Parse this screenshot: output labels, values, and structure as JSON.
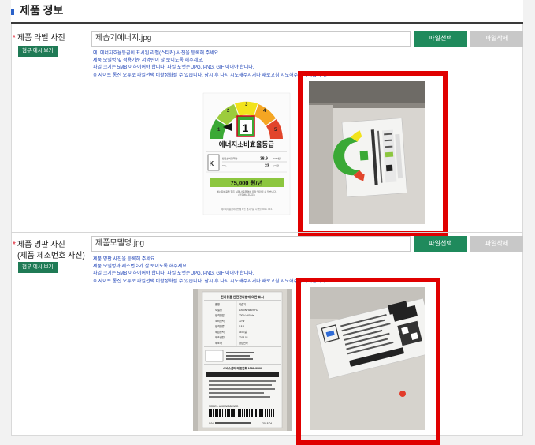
{
  "section": {
    "title": "제품 정보"
  },
  "rows": [
    {
      "label_lines": [
        "제품 라벨 사진"
      ],
      "example_button": "첨부 예시 보기",
      "file_name": "제습기에너지.jpg",
      "select_label": "파일선택",
      "delete_label": "파일삭제",
      "help_lines": [
        "예: 에너지효율등급이 표시된 라벨(스티커) 사진을 등록해 주세요.",
        "제품 모델명 및 적용기준 서명란이 잘 보이도록 해주세요.",
        "파일 크기는 5MB 이하이어야 합니다. 파일 포맷은 JPG, PNG, GIF 이어야 합니다.",
        "※ 사이트 통신 오류로 파일선택 비활성화될 수 있습니다. 잠시 후 다시 시도해주시거나 새로고침 시도해주시기 바랍니다."
      ],
      "energy_label": {
        "grades": [
          "1",
          "2",
          "3",
          "4",
          "5"
        ],
        "current_grade": "1",
        "title": "에너지소비효율등급",
        "rows": [
          {
            "k": "월간소비전력량",
            "v": "38.9",
            "u": "kWh/월"
          },
          {
            "k": "CO₂",
            "v": "23",
            "u": "g/시간"
          }
        ],
        "cost": "75,000 원/년",
        "note_lines": [
          "에너지비용을 힘든 실제 사용환경에 따라 달라질 수 있습니다.",
          "(한국에너지공단)"
        ],
        "footer": "에너지이용합리화법에 따른 효시기준 시행일 2016. 10.1"
      }
    },
    {
      "label_lines": [
        "제품 명판 사진",
        "(제품 제조번호 사진)"
      ],
      "example_button": "첨부 예시 보기",
      "file_name": "제품모델명.jpg",
      "select_label": "파일선택",
      "delete_label": "파일삭제",
      "help_lines": [
        "제품 명판 사진을 등록해 주세요.",
        "제품 모델명과 제조번호가 잘 보이도록 해주세요.",
        "파일 크기는 5MB 이하이어야 합니다. 파일 포맷은 JPG, PNG, GIF 이어야 합니다.",
        "※ 사이트 통신 오류로 파일선택 비활성화될 수 있습니다. 잠시 후 다시 시도해주시거나 새로고침 시도해주시기 바랍니다."
      ],
      "nameplate": {
        "title": "전기용품 안전관리법에 의한 표시",
        "rows": [
          {
            "k": "품명",
            "v": "제습기"
          },
          {
            "k": "모델명",
            "v": "AX80N7580WFD"
          },
          {
            "k": "정격전압",
            "v": "220 V~ 60 Hz"
          },
          {
            "k": "소비전력",
            "v": "70 W"
          },
          {
            "k": "정격전류",
            "v": "0.8 A"
          },
          {
            "k": "제습능력",
            "v": "15 L/일"
          },
          {
            "k": "제조년월",
            "v": "2018.04"
          },
          {
            "k": "제조자",
            "v": "삼성전자"
          }
        ],
        "service": "서비스센터 대표전화 1588-3366",
        "model_line": "MODEL: AX80N7580WFD",
        "serial_prefix": "S/N:",
        "date": "2018.04"
      }
    }
  ],
  "colors": {
    "accent_green": "#1f8a5c",
    "help_blue": "#1a3fb5",
    "highlight_red": "#e00000"
  }
}
